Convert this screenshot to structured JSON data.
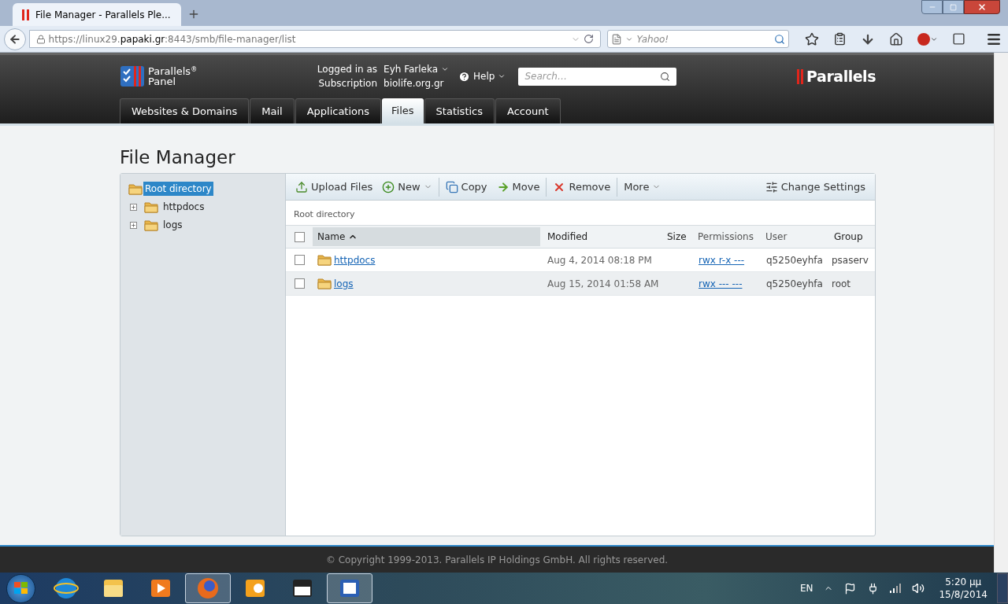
{
  "browser": {
    "tab": {
      "title": "File Manager - Parallels Ple..."
    },
    "url": {
      "prefix": "https://linux29.",
      "domain": "papaki.gr",
      "suffix": ":8443/smb/file-manager/list"
    },
    "search": {
      "placeholder": "Yahoo!"
    }
  },
  "header": {
    "logo": {
      "line1": "Parallels",
      "mark": "®",
      "line2": "Panel"
    },
    "logged_in_label": "Logged in as",
    "user_name": "Eyh Farleka",
    "subscription_label": "Subscription",
    "subscription": "biolife.org.gr",
    "help": "Help",
    "search": {
      "placeholder": "Search…"
    },
    "brand": "Parallels"
  },
  "tabs": [
    {
      "label": "Websites & Domains",
      "selected": false
    },
    {
      "label": "Mail",
      "selected": false
    },
    {
      "label": "Applications",
      "selected": false
    },
    {
      "label": "Files",
      "selected": true
    },
    {
      "label": "Statistics",
      "selected": false
    },
    {
      "label": "Account",
      "selected": false
    }
  ],
  "page_title": "File Manager",
  "tree": {
    "label": "Root directory",
    "selected": true,
    "children": [
      {
        "label": "httpdocs",
        "expanded": false,
        "selected": false
      },
      {
        "label": "logs",
        "expanded": false,
        "selected": false
      }
    ]
  },
  "toolbar": {
    "groups": [
      [
        {
          "kind": "upload",
          "label": "Upload Files",
          "menu": false
        },
        {
          "kind": "new",
          "label": "New",
          "menu": true
        }
      ],
      [
        {
          "kind": "copy",
          "label": "Copy",
          "menu": false
        },
        {
          "kind": "move",
          "label": "Move",
          "menu": false
        }
      ],
      [
        {
          "kind": "remove",
          "label": "Remove",
          "menu": false
        }
      ],
      [
        {
          "kind": "more",
          "label": "More",
          "menu": true
        }
      ]
    ],
    "settings": {
      "kind": "settings",
      "label": "Change Settings",
      "menu": false
    }
  },
  "breadcrumb": "Root directory",
  "table": {
    "select_all": {
      "checked": false
    },
    "columns": [
      {
        "label": "Name",
        "sorted": true
      },
      {
        "label": "Modified",
        "sorted": false
      },
      {
        "label": "Size",
        "sorted": false
      },
      {
        "label": "Permissions",
        "sorted": false
      },
      {
        "label": "User",
        "sorted": false
      },
      {
        "label": "Group",
        "sorted": false
      }
    ],
    "rows": [
      {
        "checked": false,
        "name": "httpdocs",
        "modified": "Aug 4, 2014 08:18 PM",
        "permissions": "rwx r-x ---",
        "user": "q5250eyhfa",
        "group": "psaserv"
      },
      {
        "checked": false,
        "name": "logs",
        "modified": "Aug 15, 2014 01:58 AM",
        "permissions": "rwx --- ---",
        "user": "q5250eyhfa",
        "group": "root"
      }
    ]
  },
  "footer": "© Copyright 1999-2013. Parallels IP Holdings GmbH. All rights reserved.",
  "taskbar": {
    "apps": [
      {
        "kind": "ie",
        "selected": false
      },
      {
        "kind": "explorer",
        "selected": false
      },
      {
        "kind": "media",
        "selected": false
      },
      {
        "kind": "firefox",
        "selected": true
      },
      {
        "kind": "outlook",
        "selected": false
      },
      {
        "kind": "clapper",
        "selected": false
      },
      {
        "kind": "word",
        "selected": true
      }
    ],
    "language": "EN",
    "time": "5:20 μμ",
    "date": "15/8/2014"
  }
}
